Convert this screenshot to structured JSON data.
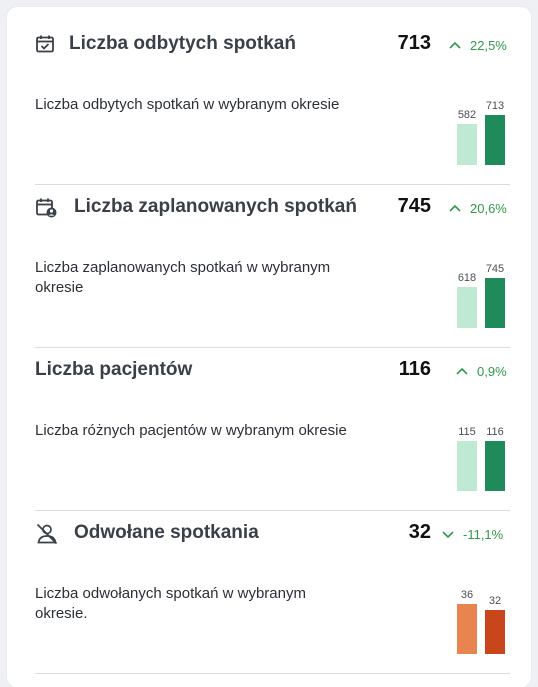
{
  "colors": {
    "prev_up": "#bfe9d3",
    "curr_up": "#1f8a5a",
    "prev_down": "#e8844f",
    "curr_down": "#c9461d",
    "trend_green": "#2f9a48"
  },
  "cards": [
    {
      "icon": "calendar-check-icon",
      "title": "Liczba odbytych spotkań",
      "value": "713",
      "trend_direction": "up",
      "trend_percent": "22,5%",
      "description": "Liczba odbytych spotkań w wybranym okresie",
      "bars": {
        "previous_label": "582",
        "current_label": "713",
        "previous": 582,
        "current": 713
      }
    },
    {
      "icon": "calendar-user-icon",
      "title": "Liczba zaplanowanych spotkań",
      "value": "745",
      "trend_direction": "up",
      "trend_percent": "20,6%",
      "description": "Liczba zaplanowanych spotkań w wybranym okresie",
      "bars": {
        "previous_label": "618",
        "current_label": "745",
        "previous": 618,
        "current": 745
      }
    },
    {
      "icon": "",
      "title": "Liczba pacjentów",
      "value": "116",
      "trend_direction": "up",
      "trend_percent": "0,9%",
      "description": "Liczba różnych pacjentów w wybranym okresie",
      "bars": {
        "previous_label": "115",
        "current_label": "116",
        "previous": 115,
        "current": 116
      }
    },
    {
      "icon": "user-cancelled-icon",
      "title": "Odwołane spotkania",
      "value": "32",
      "trend_direction": "down",
      "trend_percent": "-11,1%",
      "description": "Liczba odwołanych spotkań w wybranym okresie.",
      "bars": {
        "previous_label": "36",
        "current_label": "32",
        "previous": 36,
        "current": 32
      }
    }
  ]
}
